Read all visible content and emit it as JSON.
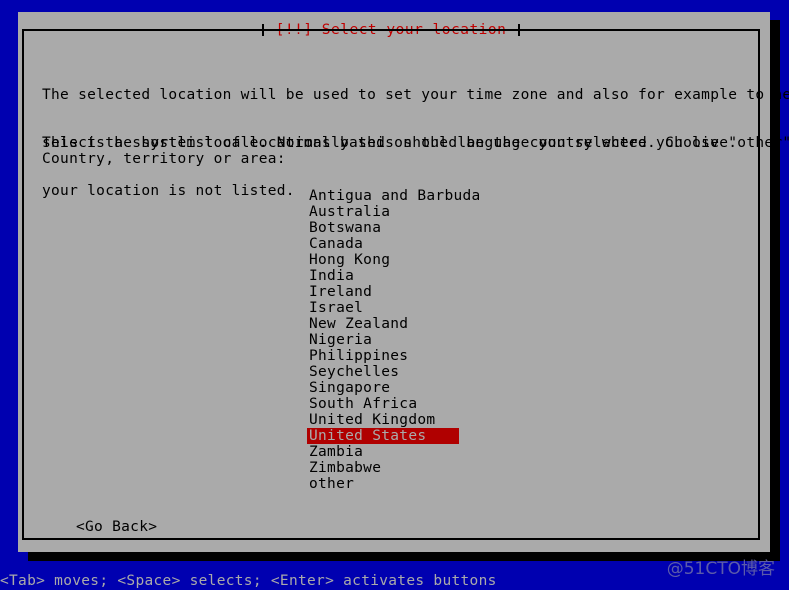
{
  "screen": {
    "background_color": "#0000b0",
    "dialog_color": "#aaaaaa",
    "title_color": "#c00000",
    "highlight_bg": "#b00000",
    "highlight_fg": "#aaaaaa"
  },
  "dialog": {
    "title": "[!!] Select your location",
    "intro_paragraph": {
      "line1": "The selected location will be used to set your time zone and also for example to help",
      "line2": "select the system locale. Normally this should be the country where you live."
    },
    "shortlist_paragraph": {
      "line1": "This is a shortlist of locations based on the language you selected. Choose \"other\" if",
      "line2": "your location is not listed."
    },
    "prompt_label": "Country, territory or area:",
    "countries": [
      {
        "label": "Antigua and Barbuda",
        "selected": false
      },
      {
        "label": "Australia",
        "selected": false
      },
      {
        "label": "Botswana",
        "selected": false
      },
      {
        "label": "Canada",
        "selected": false
      },
      {
        "label": "Hong Kong",
        "selected": false
      },
      {
        "label": "India",
        "selected": false
      },
      {
        "label": "Ireland",
        "selected": false
      },
      {
        "label": "Israel",
        "selected": false
      },
      {
        "label": "New Zealand",
        "selected": false
      },
      {
        "label": "Nigeria",
        "selected": false
      },
      {
        "label": "Philippines",
        "selected": false
      },
      {
        "label": "Seychelles",
        "selected": false
      },
      {
        "label": "Singapore",
        "selected": false
      },
      {
        "label": "South Africa",
        "selected": false
      },
      {
        "label": "United Kingdom",
        "selected": false
      },
      {
        "label": "United States",
        "selected": true
      },
      {
        "label": "Zambia",
        "selected": false
      },
      {
        "label": "Zimbabwe",
        "selected": false
      },
      {
        "label": "other",
        "selected": false
      }
    ],
    "go_back_button": "<Go Back>"
  },
  "status_bar": {
    "help_text": "<Tab> moves; <Space> selects; <Enter> activates buttons"
  },
  "watermark": {
    "text": "@51CTO博客"
  }
}
